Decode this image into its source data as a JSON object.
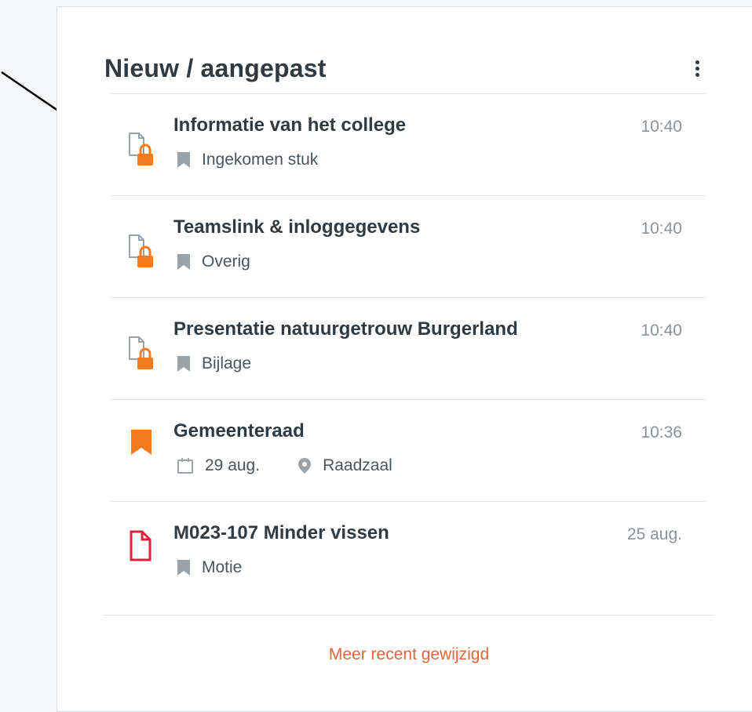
{
  "card": {
    "title": "Nieuw / aangepast",
    "menu_icon": "more-vertical-icon",
    "more_link": "Meer recent gewijzigd"
  },
  "items": [
    {
      "title": "Informatie van het college",
      "time": "10:40",
      "category": "Ingekomen stuk",
      "icon": "locked-document-icon"
    },
    {
      "title": "Teamslink & inloggegevens",
      "time": "10:40",
      "category": "Overig",
      "icon": "locked-document-icon"
    },
    {
      "title": "Presentatie natuurgetrouw Burgerland",
      "time": "10:40",
      "category": "Bijlage",
      "icon": "locked-document-icon"
    },
    {
      "title": "Gemeenteraad",
      "time": "10:36",
      "date": "29 aug.",
      "location": "Raadzaal",
      "icon": "bookmark-icon"
    },
    {
      "title": "M023-107 Minder vissen",
      "time": "25 aug.",
      "category": "Motie",
      "icon": "document-icon"
    }
  ],
  "colors": {
    "accent_orange": "#f47b20",
    "document_red": "#d9233b",
    "link_orange": "#e4643a",
    "muted_icon": "#9aa3a9"
  }
}
